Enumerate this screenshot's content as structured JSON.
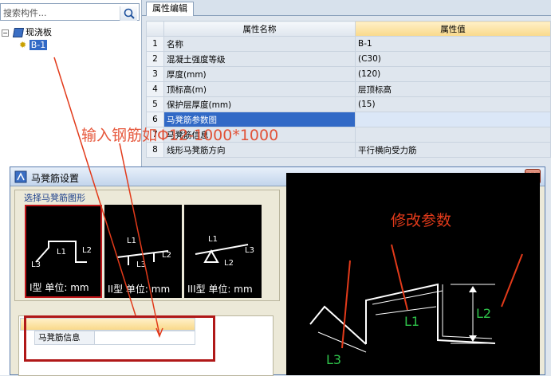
{
  "search": {
    "placeholder": "搜索构件..."
  },
  "tree": {
    "root": "现浇板",
    "child": "B-1"
  },
  "tab": {
    "label": "属性编辑"
  },
  "grid": {
    "headers": [
      "属性名称",
      "属性值"
    ],
    "rows": [
      {
        "idx": "1",
        "name": "名称",
        "value": "B-1"
      },
      {
        "idx": "2",
        "name": "混凝土强度等级",
        "value": "(C30)"
      },
      {
        "idx": "3",
        "name": "厚度(mm)",
        "value": "(120)"
      },
      {
        "idx": "4",
        "name": "顶标高(m)",
        "value": "层顶标高"
      },
      {
        "idx": "5",
        "name": "保护层厚度(mm)",
        "value": "(15)"
      },
      {
        "idx": "6",
        "name": "马凳筋参数图",
        "value": ""
      },
      {
        "idx": "7",
        "name": "马凳筋信息",
        "value": ""
      },
      {
        "idx": "8",
        "name": "线形马凳筋方向",
        "value": "平行横向受力筋"
      }
    ]
  },
  "dialog": {
    "title": "马凳筋设置",
    "close": "✕",
    "shape_group_label": "选择马凳筋图形",
    "shapes": [
      {
        "caption": "I型 单位: mm"
      },
      {
        "caption": "II型 单位: mm"
      },
      {
        "caption": "III型 单位: mm"
      }
    ],
    "info_label": "马凳筋信息"
  },
  "annotations": {
    "input_hint": "输入钢筋如Φ12-1000*1000",
    "modify_hint": "修改参数"
  },
  "preview_labels": {
    "l1": "L1",
    "l2": "L2",
    "l3": "L3"
  }
}
